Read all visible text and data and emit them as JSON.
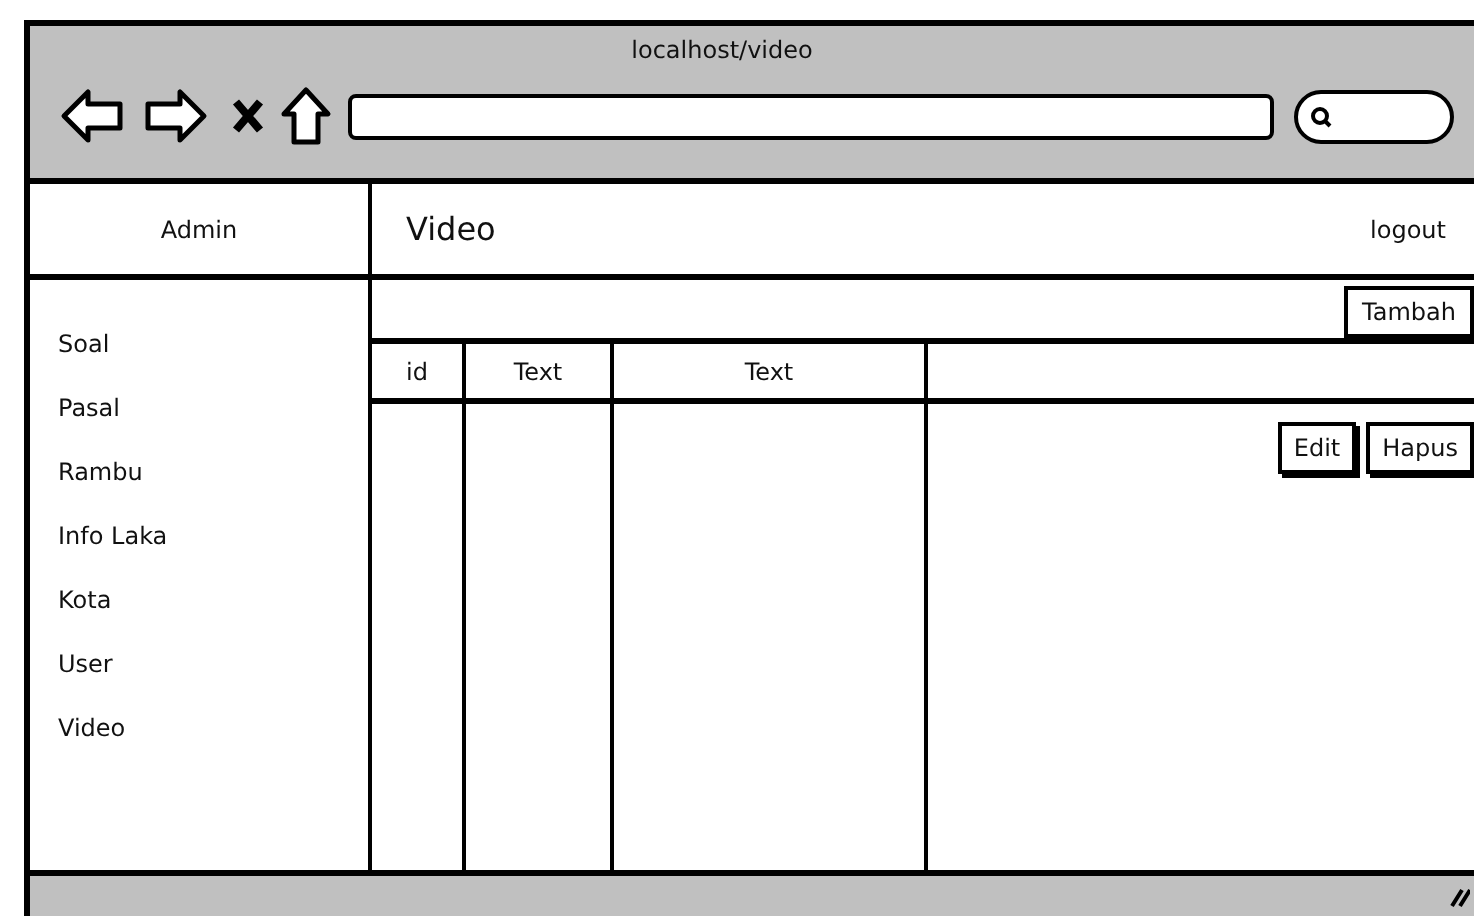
{
  "window": {
    "title": "localhost/video"
  },
  "sidebar": {
    "header": "Admin",
    "items": [
      "Soal",
      "Pasal",
      "Rambu",
      "Info Laka",
      "Kota",
      "User",
      "Video"
    ]
  },
  "header": {
    "title": "Video",
    "logout": "logout"
  },
  "toolbar": {
    "add_button": "Tambah"
  },
  "table": {
    "columns": [
      "id",
      "Text",
      "Text"
    ],
    "rows": [
      {
        "actions": [
          "Edit",
          "Hapus"
        ]
      }
    ]
  }
}
